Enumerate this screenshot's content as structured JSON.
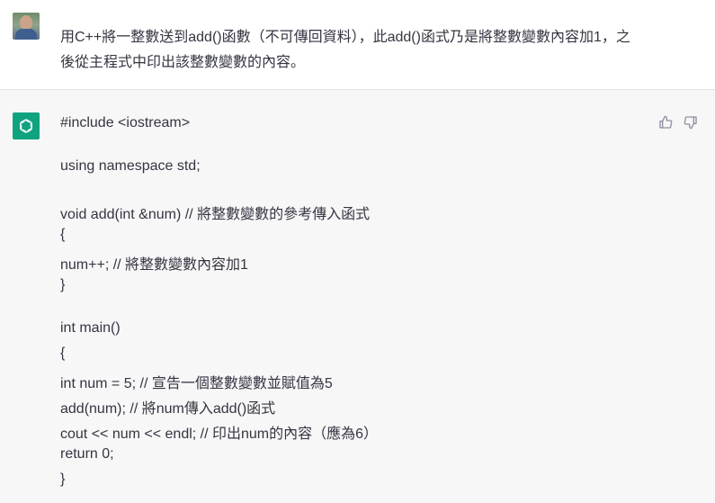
{
  "user_message": {
    "line1": "用C++將一整數送到add()函數（不可傳回資料），此add()函式乃是將整數變數內容加1，之",
    "line2": "後從主程式中印出該整數變數的內容。"
  },
  "assistant_message": {
    "lines": [
      "#include <iostream>",
      "using namespace std;",
      "void add(int &num) // 將整數變數的參考傳入函式",
      "{",
      "num++; // 將整數變數內容加1",
      "}",
      "int main()",
      "{",
      "int num = 5; // 宣告一個整數變數並賦值為5",
      "add(num); // 將num傳入add()函式",
      "cout << num << endl; // 印出num的內容（應為6）",
      "return 0;",
      "}"
    ]
  },
  "icons": {
    "user_avatar": "user-photo-avatar",
    "assistant_avatar": "openai-logo-icon",
    "like": "thumbs-up-icon",
    "dislike": "thumbs-down-icon"
  },
  "colors": {
    "assistant_avatar_bg": "#10a37f",
    "text": "#343541",
    "assistant_row_bg": "#f7f7f8"
  }
}
